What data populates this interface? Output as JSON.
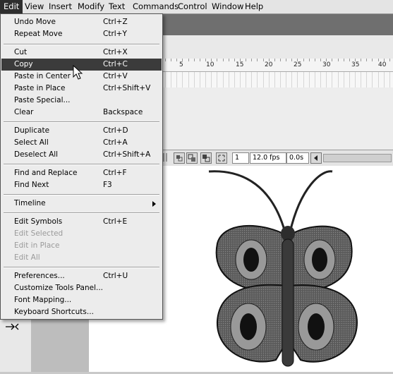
{
  "menubar": {
    "items": [
      {
        "label": "Edit",
        "active": true
      },
      {
        "label": "View",
        "active": false
      },
      {
        "label": "Insert",
        "active": false
      },
      {
        "label": "Modify",
        "active": false
      },
      {
        "label": "Text",
        "active": false
      },
      {
        "label": "Commands",
        "active": false
      },
      {
        "label": "Control",
        "active": false
      },
      {
        "label": "Window",
        "active": false
      },
      {
        "label": "Help",
        "active": false
      }
    ]
  },
  "edit_menu": {
    "items": [
      {
        "label": "Undo Move",
        "shortcut": "Ctrl+Z"
      },
      {
        "label": "Repeat Move",
        "shortcut": "Ctrl+Y"
      },
      {
        "label": "Cut",
        "shortcut": "Ctrl+X"
      },
      {
        "label": "Copy",
        "shortcut": "Ctrl+C",
        "highlighted": true
      },
      {
        "label": "Paste in Center",
        "shortcut": "Ctrl+V"
      },
      {
        "label": "Paste in Place",
        "shortcut": "Ctrl+Shift+V"
      },
      {
        "label": "Paste Special...",
        "shortcut": ""
      },
      {
        "label": "Clear",
        "shortcut": "Backspace"
      },
      {
        "label": "Duplicate",
        "shortcut": "Ctrl+D"
      },
      {
        "label": "Select All",
        "shortcut": "Ctrl+A"
      },
      {
        "label": "Deselect All",
        "shortcut": "Ctrl+Shift+A"
      },
      {
        "label": "Find and Replace",
        "shortcut": "Ctrl+F"
      },
      {
        "label": "Find Next",
        "shortcut": "F3"
      },
      {
        "label": "Timeline",
        "shortcut": "",
        "submenu": true
      },
      {
        "label": "Edit Symbols",
        "shortcut": "Ctrl+E"
      },
      {
        "label": "Edit Selected",
        "shortcut": "",
        "disabled": true
      },
      {
        "label": "Edit in Place",
        "shortcut": "",
        "disabled": true
      },
      {
        "label": "Edit All",
        "shortcut": "",
        "disabled": true
      },
      {
        "label": "Preferences...",
        "shortcut": "Ctrl+U"
      },
      {
        "label": "Customize Tools Panel...",
        "shortcut": ""
      },
      {
        "label": "Font Mapping...",
        "shortcut": ""
      },
      {
        "label": "Keyboard Shortcuts...",
        "shortcut": ""
      }
    ]
  },
  "timeline": {
    "ruler_numbers": [
      "5",
      "10",
      "15",
      "20",
      "25",
      "30",
      "35",
      "40"
    ],
    "current_frame": "1",
    "frame_rate": "12.0 fps",
    "elapsed_time": "0.0s"
  },
  "colors": {
    "menu_highlight": "#3b3b3b",
    "menubar_active": "#2e2e2e"
  }
}
